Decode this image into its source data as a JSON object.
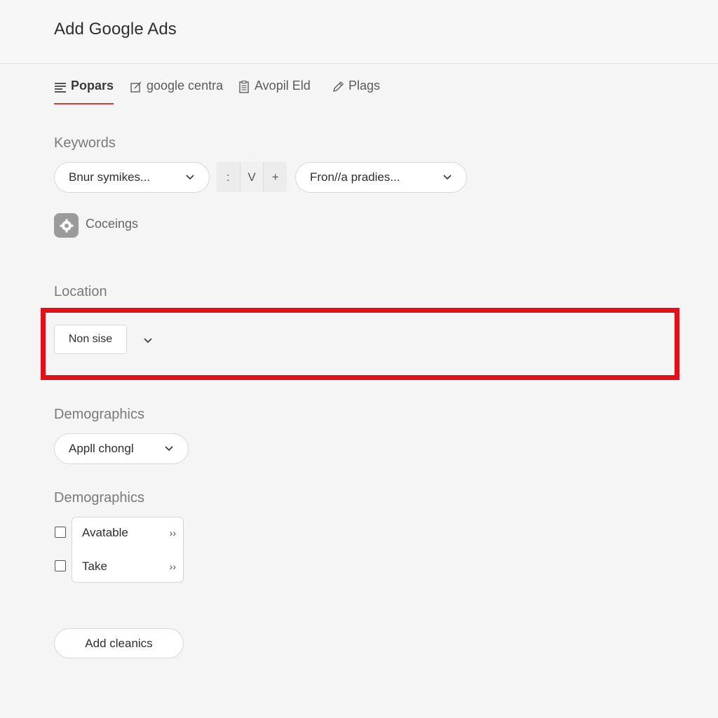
{
  "header": {
    "title": "Add Google Ads"
  },
  "tabs": [
    {
      "label": "Popars",
      "icon": "list-icon",
      "active": true
    },
    {
      "label": "google centra",
      "icon": "edit-icon",
      "active": false
    },
    {
      "label": "Avopil Eld",
      "icon": "clipboard-icon",
      "active": false
    },
    {
      "label": "Plags",
      "icon": "pencil-icon",
      "active": false
    }
  ],
  "keywords": {
    "label": "Keywords",
    "select_1": "Bnur symikes...",
    "stepper": [
      ":",
      "V",
      "+"
    ],
    "select_2": "Fron//a pradies...",
    "settings_label": "Coceings"
  },
  "location": {
    "label": "Location",
    "select_value": "Non sise",
    "highlight_color": "#e3101a"
  },
  "demographics_1": {
    "label": "Demographics",
    "select_value": "Appll chongl"
  },
  "demographics_2": {
    "label": "Demographics",
    "items": [
      {
        "label": "Avatable",
        "arrow": "››",
        "checked": false
      },
      {
        "label": "Take",
        "arrow": "››",
        "checked": false
      }
    ]
  },
  "actions": {
    "add_label": "Add cleanics"
  },
  "colors": {
    "accent": "#d93a3a",
    "background": "#f4f5f4"
  }
}
